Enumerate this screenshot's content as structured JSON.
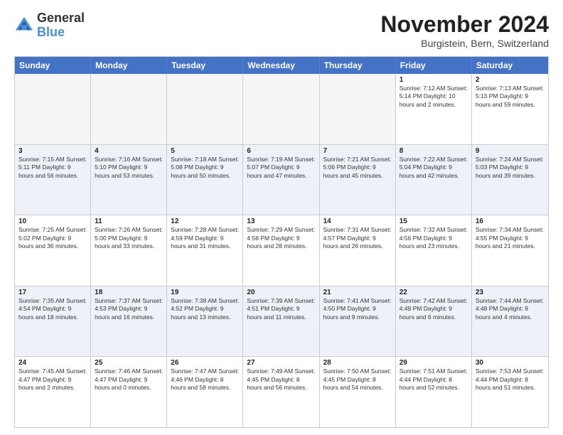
{
  "logo": {
    "line1": "General",
    "line2": "Blue"
  },
  "title": "November 2024",
  "subtitle": "Burgistein, Bern, Switzerland",
  "header_days": [
    "Sunday",
    "Monday",
    "Tuesday",
    "Wednesday",
    "Thursday",
    "Friday",
    "Saturday"
  ],
  "rows": [
    {
      "alt": false,
      "cells": [
        {
          "day": "",
          "info": "",
          "empty": true
        },
        {
          "day": "",
          "info": "",
          "empty": true
        },
        {
          "day": "",
          "info": "",
          "empty": true
        },
        {
          "day": "",
          "info": "",
          "empty": true
        },
        {
          "day": "",
          "info": "",
          "empty": true
        },
        {
          "day": "1",
          "info": "Sunrise: 7:12 AM\nSunset: 5:14 PM\nDaylight: 10 hours and 2 minutes.",
          "empty": false
        },
        {
          "day": "2",
          "info": "Sunrise: 7:13 AM\nSunset: 5:13 PM\nDaylight: 9 hours and 59 minutes.",
          "empty": false
        }
      ]
    },
    {
      "alt": true,
      "cells": [
        {
          "day": "3",
          "info": "Sunrise: 7:15 AM\nSunset: 5:11 PM\nDaylight: 9 hours and 56 minutes.",
          "empty": false
        },
        {
          "day": "4",
          "info": "Sunrise: 7:16 AM\nSunset: 5:10 PM\nDaylight: 9 hours and 53 minutes.",
          "empty": false
        },
        {
          "day": "5",
          "info": "Sunrise: 7:18 AM\nSunset: 5:08 PM\nDaylight: 9 hours and 50 minutes.",
          "empty": false
        },
        {
          "day": "6",
          "info": "Sunrise: 7:19 AM\nSunset: 5:07 PM\nDaylight: 9 hours and 47 minutes.",
          "empty": false
        },
        {
          "day": "7",
          "info": "Sunrise: 7:21 AM\nSunset: 5:06 PM\nDaylight: 9 hours and 45 minutes.",
          "empty": false
        },
        {
          "day": "8",
          "info": "Sunrise: 7:22 AM\nSunset: 5:04 PM\nDaylight: 9 hours and 42 minutes.",
          "empty": false
        },
        {
          "day": "9",
          "info": "Sunrise: 7:24 AM\nSunset: 5:03 PM\nDaylight: 9 hours and 39 minutes.",
          "empty": false
        }
      ]
    },
    {
      "alt": false,
      "cells": [
        {
          "day": "10",
          "info": "Sunrise: 7:25 AM\nSunset: 5:02 PM\nDaylight: 9 hours and 36 minutes.",
          "empty": false
        },
        {
          "day": "11",
          "info": "Sunrise: 7:26 AM\nSunset: 5:00 PM\nDaylight: 9 hours and 33 minutes.",
          "empty": false
        },
        {
          "day": "12",
          "info": "Sunrise: 7:28 AM\nSunset: 4:59 PM\nDaylight: 9 hours and 31 minutes.",
          "empty": false
        },
        {
          "day": "13",
          "info": "Sunrise: 7:29 AM\nSunset: 4:58 PM\nDaylight: 9 hours and 28 minutes.",
          "empty": false
        },
        {
          "day": "14",
          "info": "Sunrise: 7:31 AM\nSunset: 4:57 PM\nDaylight: 9 hours and 26 minutes.",
          "empty": false
        },
        {
          "day": "15",
          "info": "Sunrise: 7:32 AM\nSunset: 4:56 PM\nDaylight: 9 hours and 23 minutes.",
          "empty": false
        },
        {
          "day": "16",
          "info": "Sunrise: 7:34 AM\nSunset: 4:55 PM\nDaylight: 9 hours and 21 minutes.",
          "empty": false
        }
      ]
    },
    {
      "alt": true,
      "cells": [
        {
          "day": "17",
          "info": "Sunrise: 7:35 AM\nSunset: 4:54 PM\nDaylight: 9 hours and 18 minutes.",
          "empty": false
        },
        {
          "day": "18",
          "info": "Sunrise: 7:37 AM\nSunset: 4:53 PM\nDaylight: 9 hours and 16 minutes.",
          "empty": false
        },
        {
          "day": "19",
          "info": "Sunrise: 7:38 AM\nSunset: 4:52 PM\nDaylight: 9 hours and 13 minutes.",
          "empty": false
        },
        {
          "day": "20",
          "info": "Sunrise: 7:39 AM\nSunset: 4:51 PM\nDaylight: 9 hours and 11 minutes.",
          "empty": false
        },
        {
          "day": "21",
          "info": "Sunrise: 7:41 AM\nSunset: 4:50 PM\nDaylight: 9 hours and 9 minutes.",
          "empty": false
        },
        {
          "day": "22",
          "info": "Sunrise: 7:42 AM\nSunset: 4:49 PM\nDaylight: 9 hours and 6 minutes.",
          "empty": false
        },
        {
          "day": "23",
          "info": "Sunrise: 7:44 AM\nSunset: 4:48 PM\nDaylight: 9 hours and 4 minutes.",
          "empty": false
        }
      ]
    },
    {
      "alt": false,
      "cells": [
        {
          "day": "24",
          "info": "Sunrise: 7:45 AM\nSunset: 4:47 PM\nDaylight: 9 hours and 2 minutes.",
          "empty": false
        },
        {
          "day": "25",
          "info": "Sunrise: 7:46 AM\nSunset: 4:47 PM\nDaylight: 9 hours and 0 minutes.",
          "empty": false
        },
        {
          "day": "26",
          "info": "Sunrise: 7:47 AM\nSunset: 4:46 PM\nDaylight: 8 hours and 58 minutes.",
          "empty": false
        },
        {
          "day": "27",
          "info": "Sunrise: 7:49 AM\nSunset: 4:45 PM\nDaylight: 8 hours and 56 minutes.",
          "empty": false
        },
        {
          "day": "28",
          "info": "Sunrise: 7:50 AM\nSunset: 4:45 PM\nDaylight: 8 hours and 54 minutes.",
          "empty": false
        },
        {
          "day": "29",
          "info": "Sunrise: 7:51 AM\nSunset: 4:44 PM\nDaylight: 8 hours and 52 minutes.",
          "empty": false
        },
        {
          "day": "30",
          "info": "Sunrise: 7:53 AM\nSunset: 4:44 PM\nDaylight: 8 hours and 51 minutes.",
          "empty": false
        }
      ]
    }
  ]
}
